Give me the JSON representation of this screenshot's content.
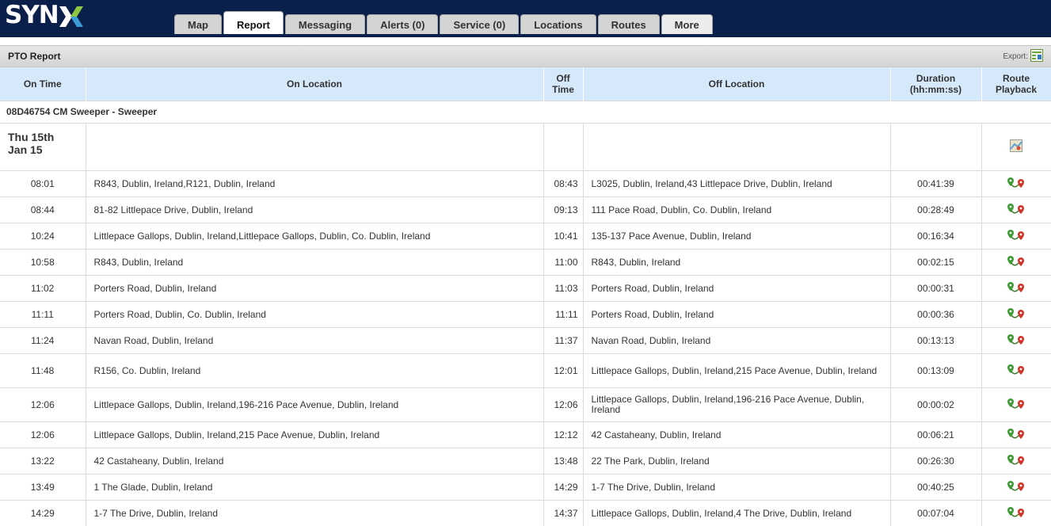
{
  "brand": {
    "logo_text": "SYN",
    "accent": "#8ec63f"
  },
  "tabs": [
    {
      "label": "Map"
    },
    {
      "label": "Report",
      "active": true
    },
    {
      "label": "Messaging"
    },
    {
      "label": "Alerts (0)"
    },
    {
      "label": "Service (0)"
    },
    {
      "label": "Locations"
    },
    {
      "label": "Routes"
    },
    {
      "label": "More"
    }
  ],
  "report": {
    "title": "PTO Report",
    "export_label": "Export:"
  },
  "columns": {
    "on_time": "On Time",
    "on_location": "On Location",
    "off_time_1": "Off",
    "off_time_2": "Time",
    "off_location": "Off Location",
    "duration_1": "Duration",
    "duration_2": "(hh:mm:ss)",
    "playback_1": "Route",
    "playback_2": "Playback"
  },
  "vehicle": "08D46754 CM Sweeper - Sweeper",
  "date": {
    "line1": "Thu 15th",
    "line2": "Jan 15"
  },
  "rows": [
    {
      "on_time": "08:01",
      "on_location": "R843, Dublin, Ireland,R121, Dublin, Ireland",
      "off_time": "08:43",
      "off_location": "L3025, Dublin, Ireland,43 Littlepace Drive, Dublin, Ireland",
      "duration": "00:41:39"
    },
    {
      "on_time": "08:44",
      "on_location": "81-82 Littlepace Drive, Dublin, Ireland",
      "off_time": "09:13",
      "off_location": "111 Pace Road, Dublin, Co. Dublin, Ireland",
      "duration": "00:28:49"
    },
    {
      "on_time": "10:24",
      "on_location": "Littlepace Gallops, Dublin, Ireland,Littlepace Gallops, Dublin, Co. Dublin, Ireland",
      "off_time": "10:41",
      "off_location": "135-137 Pace Avenue, Dublin, Ireland",
      "duration": "00:16:34"
    },
    {
      "on_time": "10:58",
      "on_location": "R843, Dublin, Ireland",
      "off_time": "11:00",
      "off_location": "R843, Dublin, Ireland",
      "duration": "00:02:15"
    },
    {
      "on_time": "11:02",
      "on_location": "Porters Road, Dublin, Ireland",
      "off_time": "11:03",
      "off_location": "Porters Road, Dublin, Ireland",
      "duration": "00:00:31"
    },
    {
      "on_time": "11:11",
      "on_location": "Porters Road, Dublin, Co. Dublin, Ireland",
      "off_time": "11:11",
      "off_location": "Porters Road, Dublin, Ireland",
      "duration": "00:00:36"
    },
    {
      "on_time": "11:24",
      "on_location": "Navan Road, Dublin, Ireland",
      "off_time": "11:37",
      "off_location": "Navan Road, Dublin, Ireland",
      "duration": "00:13:13"
    },
    {
      "on_time": "11:48",
      "on_location": "R156, Co. Dublin, Ireland",
      "off_time": "12:01",
      "off_location": "Littlepace Gallops, Dublin, Ireland,215 Pace Avenue, Dublin, Ireland",
      "duration": "00:13:09",
      "tall": true
    },
    {
      "on_time": "12:06",
      "on_location": "Littlepace Gallops, Dublin, Ireland,196-216 Pace Avenue, Dublin, Ireland",
      "off_time": "12:06",
      "off_location": "Littlepace Gallops, Dublin, Ireland,196-216 Pace Avenue, Dublin, Ireland",
      "duration": "00:00:02",
      "tall": true
    },
    {
      "on_time": "12:06",
      "on_location": "Littlepace Gallops, Dublin, Ireland,215 Pace Avenue, Dublin, Ireland",
      "off_time": "12:12",
      "off_location": "42 Castaheany, Dublin, Ireland",
      "duration": "00:06:21"
    },
    {
      "on_time": "13:22",
      "on_location": "42 Castaheany, Dublin, Ireland",
      "off_time": "13:48",
      "off_location": "22 The Park, Dublin, Ireland",
      "duration": "00:26:30"
    },
    {
      "on_time": "13:49",
      "on_location": "1 The Glade, Dublin, Ireland",
      "off_time": "14:29",
      "off_location": "1-7 The Drive, Dublin, Ireland",
      "duration": "00:40:25"
    },
    {
      "on_time": "14:29",
      "on_location": "1-7 The Drive, Dublin, Ireland",
      "off_time": "14:37",
      "off_location": "Littlepace Gallops, Dublin, Ireland,4 The Drive, Dublin, Ireland",
      "duration": "00:07:04"
    }
  ]
}
